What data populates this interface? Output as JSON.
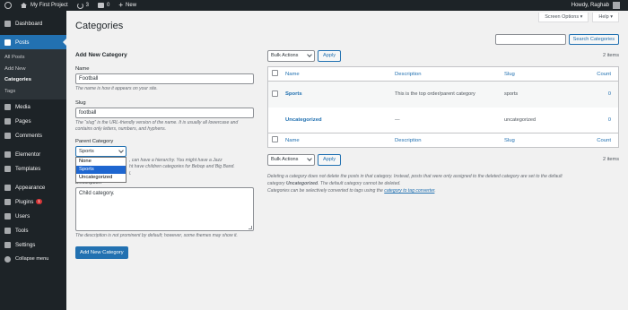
{
  "adminbar": {
    "site_name": "My First Project",
    "updates_count": "3",
    "comments_count": "0",
    "new_label": "New",
    "greeting": "Howdy, Raghab"
  },
  "sidebar": {
    "items": [
      {
        "label": "Dashboard",
        "icon": "dashboard-icon"
      },
      {
        "label": "Posts",
        "icon": "pin-icon"
      },
      {
        "label": "Media",
        "icon": "media-icon"
      },
      {
        "label": "Pages",
        "icon": "pages-icon"
      },
      {
        "label": "Comments",
        "icon": "comments-icon"
      },
      {
        "label": "Elementor",
        "icon": "elementor-icon"
      },
      {
        "label": "Templates",
        "icon": "templates-icon"
      },
      {
        "label": "Appearance",
        "icon": "appearance-icon"
      },
      {
        "label": "Plugins",
        "icon": "plugins-icon",
        "badge": "1"
      },
      {
        "label": "Users",
        "icon": "users-icon"
      },
      {
        "label": "Tools",
        "icon": "tools-icon"
      },
      {
        "label": "Settings",
        "icon": "settings-icon"
      },
      {
        "label": "Collapse menu",
        "icon": "collapse-icon"
      }
    ],
    "posts_submenu": [
      "All Posts",
      "Add New",
      "Categories",
      "Tags"
    ]
  },
  "header": {
    "title": "Categories",
    "screen_options": "Screen Options ▾",
    "help": "Help ▾"
  },
  "search": {
    "button_label": "Search Categories",
    "value": ""
  },
  "form": {
    "heading": "Add New Category",
    "name_label": "Name",
    "name_value": "Football",
    "name_help": "The name is how it appears on your site.",
    "slug_label": "Slug",
    "slug_value": "football",
    "slug_help": "The “slug” is the URL-friendly version of the name. It is usually all lowercase and contains only letters, numbers, and hyphens.",
    "parent_label": "Parent Category",
    "parent_selected": "Sports",
    "parent_options": [
      "None",
      "Sports",
      "Uncategorized"
    ],
    "parent_help_line1": ", can have a hierarchy. You might have a Jazz",
    "parent_help_line2": "ht have children categories for Bebop and Big Band.",
    "parent_help_line3": "l.",
    "description_label": "Description",
    "description_value": "Child category.",
    "description_help": "The description is not prominent by default; however, some themes may show it.",
    "submit_label": "Add New Category"
  },
  "table": {
    "bulk_actions": "Bulk Actions",
    "apply": "Apply",
    "items_count": "2 items",
    "columns": [
      "Name",
      "Description",
      "Slug",
      "Count"
    ],
    "rows": [
      {
        "name": "Sports",
        "description": "This is the top order/parent category",
        "slug": "sports",
        "count": "0"
      },
      {
        "name": "Uncategorized",
        "description": "—",
        "slug": "uncategorized",
        "count": "0"
      }
    ]
  },
  "notes": {
    "line1_a": "Deleting a category does not delete the posts in that category. Instead, posts that were only assigned to the deleted category are set to the default",
    "line2_a": "category",
    "line2_em": "Uncategorized",
    "line2_b": ". The default category cannot be deleted.",
    "line3_a": "Categories can be selectively converted to tags using the",
    "line3_link": "category to tag converter",
    "line3_b": "."
  },
  "colors": {
    "accent": "#2271b1",
    "sidebar_bg": "#1d2327",
    "page_bg": "#f1f1f1"
  }
}
